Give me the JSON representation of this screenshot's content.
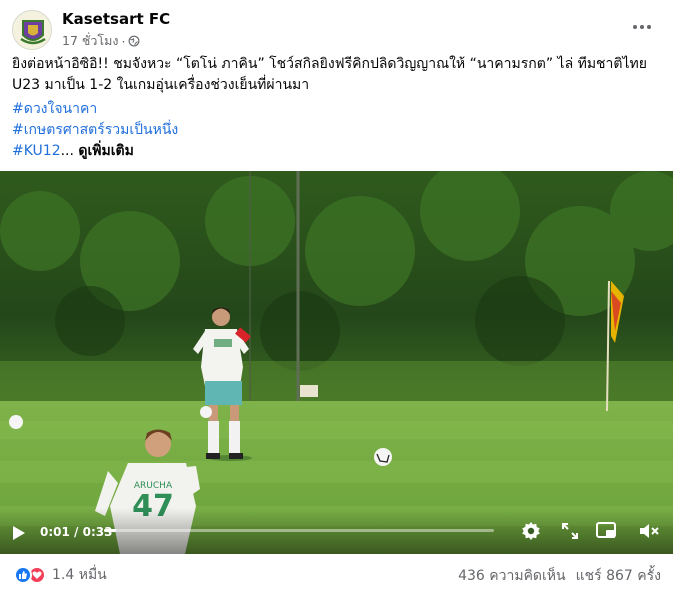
{
  "post": {
    "page_name": "Kasetsart FC",
    "time": "17 ชั่วโมง",
    "separator": "·",
    "text": "ยิงต่อหน้าอิซิอิ!! ชมจังหวะ “โตโน่ ภาคิน” โชว์สกิลยิงฟรีคิกปลิดวิญญาณให้ “นาคามรกต” ไล่ ทีมชาติไทย U23 มาเป็น 1-2 ในเกมอุ่นเครื่องช่วงเย็นที่ผ่านมา",
    "hashtags": [
      "#ดวงใจนาคา",
      "#เกษตรศาสตร์รวมเป็นหนึ่ง"
    ],
    "last_hashtag": "#KU12",
    "ellipsis": "...",
    "see_more": "ดูเพิ่มเติม"
  },
  "video": {
    "time_current": "0:01",
    "time_sep": " / ",
    "time_total": "0:33",
    "progress": 0.03,
    "jersey_name": "ARUCHA",
    "jersey_number": "47"
  },
  "footer": {
    "reaction_count": "1.4 หมื่น",
    "comments": "436 ความคิดเห็น",
    "shares": "แชร์ 867 ครั้ง"
  },
  "colors": {
    "link": "#216fdb",
    "meta": "#65676b",
    "like": "#1877f2",
    "love": "#f33e58",
    "flag": "#e6b400"
  },
  "icons": [
    "globe-icon",
    "more-icon",
    "play-icon",
    "settings-icon",
    "fullscreen-icon",
    "pip-icon",
    "volume-icon",
    "like-icon",
    "love-icon"
  ]
}
